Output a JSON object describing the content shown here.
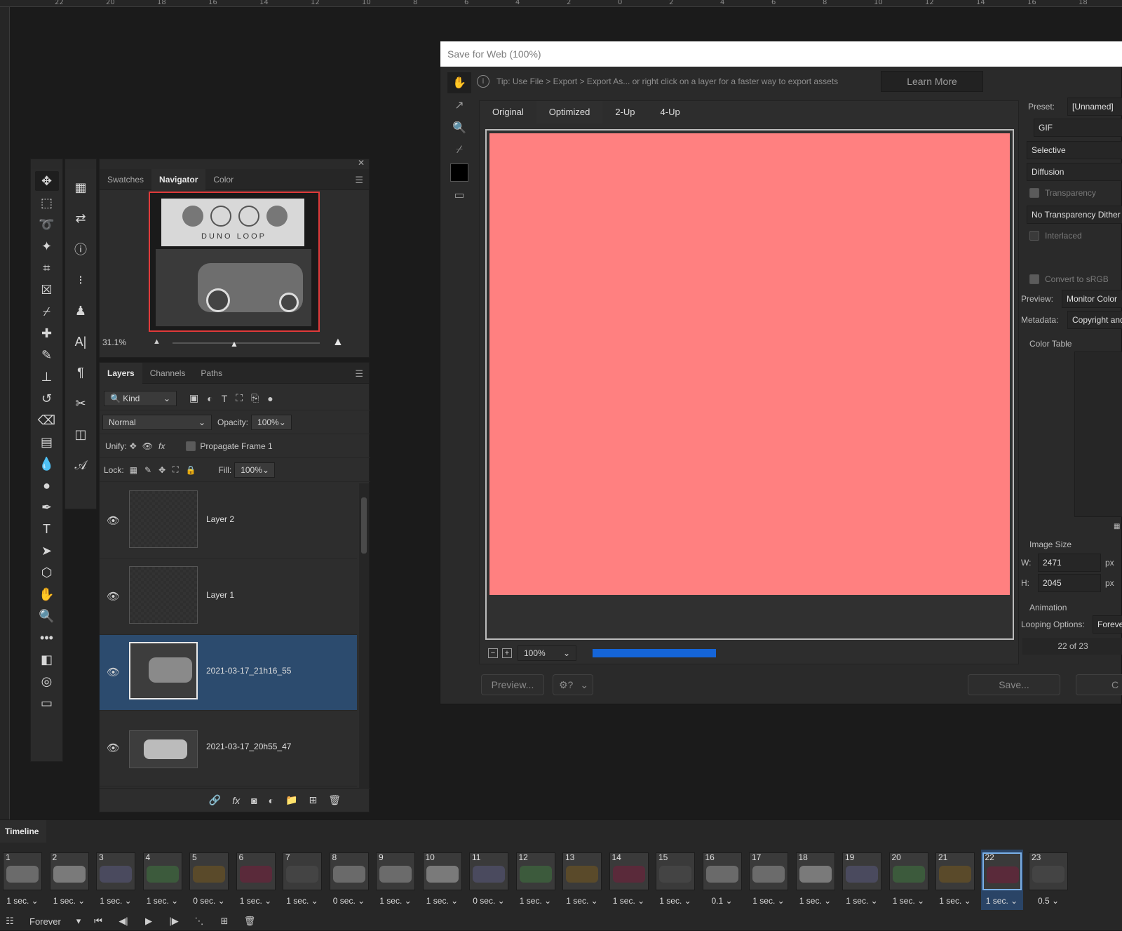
{
  "ruler": {
    "labels": [
      "22",
      "20",
      "18",
      "16",
      "14",
      "12",
      "10",
      "8",
      "6",
      "4",
      "2",
      "0",
      "2",
      "4",
      "6",
      "8",
      "10",
      "12",
      "14",
      "16",
      "18"
    ]
  },
  "navigator": {
    "tabs": [
      "Swatches",
      "Navigator",
      "Color"
    ],
    "active_tab": "Navigator",
    "zoom": "31.1%",
    "logo_text": "D U N O   L O O P"
  },
  "layers_panel": {
    "tabs": [
      "Layers",
      "Channels",
      "Paths"
    ],
    "filter_kind": "Kind",
    "blend_mode": "Normal",
    "opacity_label": "Opacity:",
    "opacity_value": "100%",
    "unify_label": "Unify:",
    "propagate_label": "Propagate Frame 1",
    "lock_label": "Lock:",
    "fill_label": "Fill:",
    "fill_value": "100%",
    "layers": [
      {
        "name": "Layer 2",
        "selected": false
      },
      {
        "name": "Layer 1",
        "selected": false
      },
      {
        "name": "2021-03-17_21h16_55",
        "selected": true
      },
      {
        "name": "2021-03-17_20h55_47",
        "selected": false
      }
    ]
  },
  "dialog": {
    "title": "Save for Web (100%)",
    "tip": "Tip: Use File > Export > Export As...  or right click on a layer for a faster way to export assets",
    "learn_more": "Learn More",
    "tabs": [
      "Original",
      "Optimized",
      "2-Up",
      "4-Up"
    ],
    "active_tab": "Optimized",
    "zoom": "100%",
    "preview_btn": "Preview...",
    "save_btn": "Save...",
    "settings": {
      "preset_label": "Preset:",
      "preset_value": "[Unnamed]",
      "format": "GIF",
      "reduction": "Selective",
      "dither": "Diffusion",
      "transparency_label": "Transparency",
      "transparency_dither": "No Transparency Dither",
      "interlaced_label": "Interlaced",
      "convert_srgb_label": "Convert to sRGB",
      "preview_label": "Preview:",
      "preview_value": "Monitor Color",
      "metadata_label": "Metadata:",
      "metadata_value": "Copyright and Contact Info",
      "color_table_label": "Color Table",
      "image_size_label": "Image Size",
      "w_label": "W:",
      "w_value": "2471",
      "h_label": "H:",
      "h_value": "2045",
      "px": "px",
      "animation_label": "Animation",
      "looping_label": "Looping Options:",
      "looping_value": "Forever",
      "frame_counter": "22 of 23"
    }
  },
  "timeline": {
    "title": "Timeline",
    "loop": "Forever",
    "frames": [
      {
        "n": "1",
        "d": "1 sec."
      },
      {
        "n": "2",
        "d": "1 sec."
      },
      {
        "n": "3",
        "d": "1 sec."
      },
      {
        "n": "4",
        "d": "1 sec."
      },
      {
        "n": "5",
        "d": "0 sec."
      },
      {
        "n": "6",
        "d": "1 sec."
      },
      {
        "n": "7",
        "d": "1 sec."
      },
      {
        "n": "8",
        "d": "0 sec."
      },
      {
        "n": "9",
        "d": "1 sec."
      },
      {
        "n": "10",
        "d": "1 sec."
      },
      {
        "n": "11",
        "d": "0 sec."
      },
      {
        "n": "12",
        "d": "1 sec."
      },
      {
        "n": "13",
        "d": "1 sec."
      },
      {
        "n": "14",
        "d": "1 sec."
      },
      {
        "n": "15",
        "d": "1 sec."
      },
      {
        "n": "16",
        "d": "0.1"
      },
      {
        "n": "17",
        "d": "1 sec."
      },
      {
        "n": "18",
        "d": "1 sec."
      },
      {
        "n": "19",
        "d": "1 sec."
      },
      {
        "n": "20",
        "d": "1 sec."
      },
      {
        "n": "21",
        "d": "1 sec."
      },
      {
        "n": "22",
        "d": "1 sec."
      },
      {
        "n": "23",
        "d": "0.5"
      }
    ],
    "selected_frame": "22"
  },
  "colors": {
    "preview_fill": "#ff8080",
    "selection_blue": "#2c4b6e",
    "progress_blue": "#1565d8"
  }
}
